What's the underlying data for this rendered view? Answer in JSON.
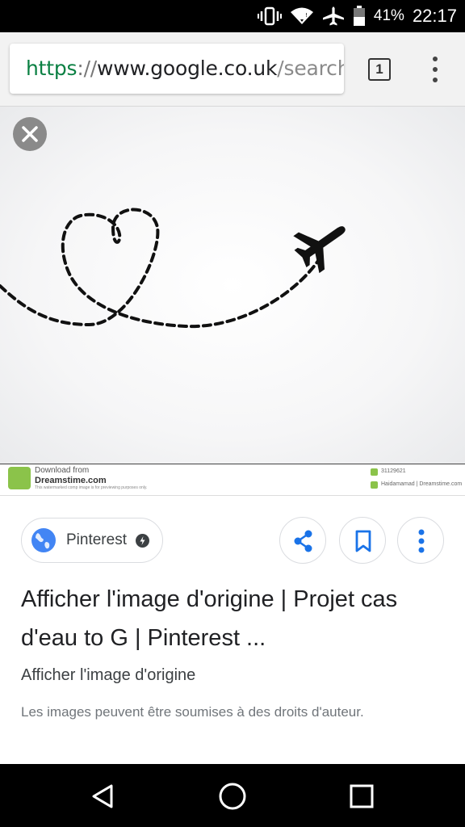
{
  "status_bar": {
    "battery_percent": "41%",
    "time": "22:17",
    "icons": [
      "vibrate-icon",
      "wifi-icon",
      "airplane-mode-icon",
      "battery-icon"
    ]
  },
  "browser": {
    "url_scheme": "https",
    "url_separator": "://",
    "url_host": "www.google.co.uk",
    "url_path": "/search?",
    "tab_count": "1"
  },
  "image_viewer": {
    "watermark": {
      "line1": "Download from",
      "line2": "Dreamstime.com",
      "line3": "This watermarked comp image is for previewing purposes only.",
      "id": "31129621",
      "author": "Haidamamad | Dreamstime.com"
    }
  },
  "result": {
    "source_label": "Pinterest",
    "title": "Afficher l'image d'origine | Projet cas d'eau to G | Pinterest ...",
    "subtitle": "Afficher l'image d'origine",
    "note": "Les images peuvent être soumises à des droits d'auteur."
  },
  "colors": {
    "url_scheme": "#0b8043",
    "accent_blue": "#1a73e8",
    "dreamstime_green": "#8bc34a"
  }
}
